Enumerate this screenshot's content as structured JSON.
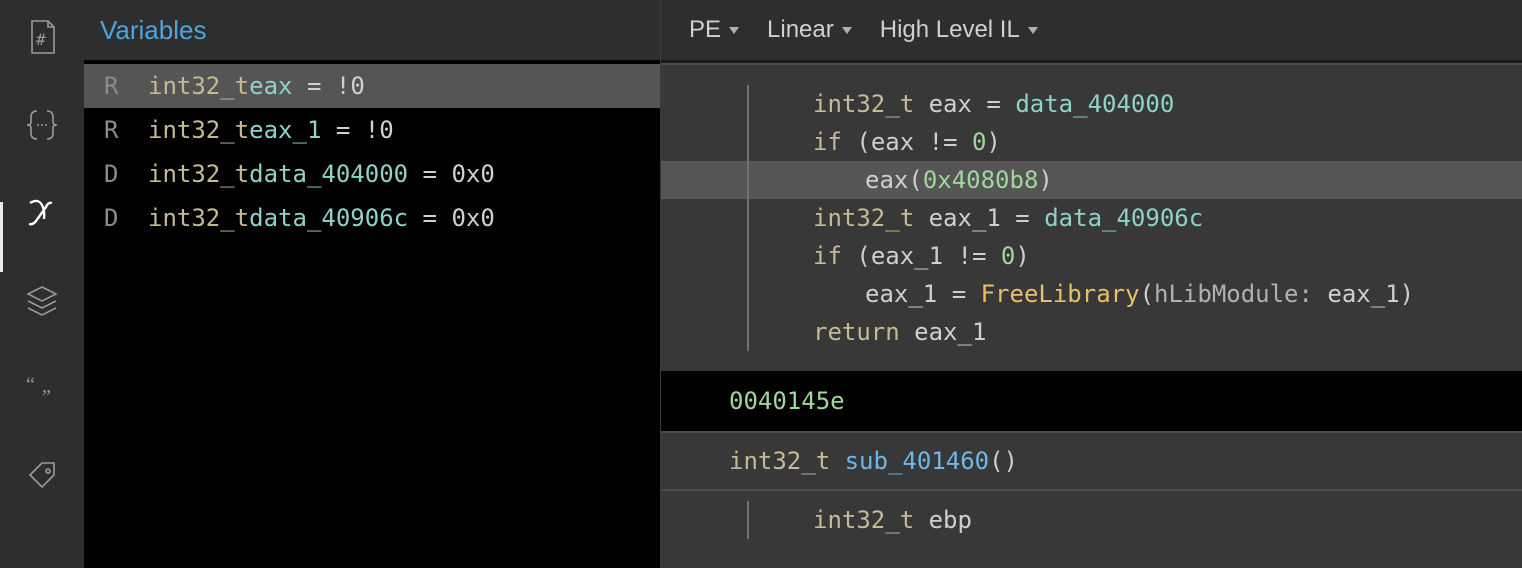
{
  "sidebar": {
    "icons": [
      "hash",
      "braces",
      "x-var",
      "layers",
      "quotes",
      "tag"
    ],
    "selected": "x-var"
  },
  "variables": {
    "title": "Variables",
    "rows": [
      {
        "tag": "R",
        "type": "int32_t",
        "name": "eax",
        "eq": " = ",
        "val": "!0",
        "selected": true
      },
      {
        "tag": "R",
        "type": "int32_t",
        "name": "eax_1",
        "eq": " = ",
        "val": "!0",
        "selected": false
      },
      {
        "tag": "D",
        "type": "int32_t",
        "name": "data_404000",
        "eq": " = ",
        "val": "0x0",
        "selected": false
      },
      {
        "tag": "D",
        "type": "int32_t",
        "name": "data_40906c",
        "eq": " = ",
        "val": "0x0",
        "selected": false
      }
    ]
  },
  "decompiler": {
    "header": {
      "file_type": "PE",
      "view_mode": "Linear",
      "il_level": "High Level IL"
    },
    "block1": [
      {
        "ind": 0,
        "t": [
          [
            "ctype",
            "int32_t"
          ],
          [
            "cop",
            " "
          ],
          [
            "cvar",
            "eax"
          ],
          [
            "cop",
            " = "
          ],
          [
            "cident",
            "data_404000"
          ]
        ]
      },
      {
        "ind": 0,
        "t": [
          [
            "ckw",
            "if"
          ],
          [
            "cop",
            " ("
          ],
          [
            "cvar",
            "eax"
          ],
          [
            "cop",
            " != "
          ],
          [
            "cnum",
            "0"
          ],
          [
            "cop",
            ")"
          ]
        ]
      },
      {
        "ind": 1,
        "hl": true,
        "t": [
          [
            "cvar",
            "eax"
          ],
          [
            "cop",
            "("
          ],
          [
            "cnum",
            "0x4080b8"
          ],
          [
            "cop",
            ")"
          ]
        ]
      },
      {
        "ind": 0,
        "t": [
          [
            "ctype",
            "int32_t"
          ],
          [
            "cop",
            " "
          ],
          [
            "cvar",
            "eax_1"
          ],
          [
            "cop",
            " = "
          ],
          [
            "cident",
            "data_40906c"
          ]
        ]
      },
      {
        "ind": 0,
        "t": [
          [
            "ckw",
            "if"
          ],
          [
            "cop",
            " ("
          ],
          [
            "cvar",
            "eax_1"
          ],
          [
            "cop",
            " != "
          ],
          [
            "cnum",
            "0"
          ],
          [
            "cop",
            ")"
          ]
        ]
      },
      {
        "ind": 1,
        "t": [
          [
            "cvar",
            "eax_1"
          ],
          [
            "cop",
            " = "
          ],
          [
            "cfunc",
            "FreeLibrary"
          ],
          [
            "cop",
            "("
          ],
          [
            "cparam",
            "hLibModule: "
          ],
          [
            "cvar",
            "eax_1"
          ],
          [
            "cop",
            ")"
          ]
        ]
      },
      {
        "ind": 0,
        "t": [
          [
            "ckw",
            "return"
          ],
          [
            "cop",
            " "
          ],
          [
            "cvar",
            "eax_1"
          ]
        ]
      }
    ],
    "address": "0040145e",
    "signature": {
      "ret": "int32_t",
      "name": "sub_401460",
      "params": "()"
    },
    "block2": [
      {
        "ind": 0,
        "t": [
          [
            "ctype",
            "int32_t"
          ],
          [
            "cop",
            " "
          ],
          [
            "cvar",
            "ebp"
          ]
        ]
      }
    ]
  }
}
